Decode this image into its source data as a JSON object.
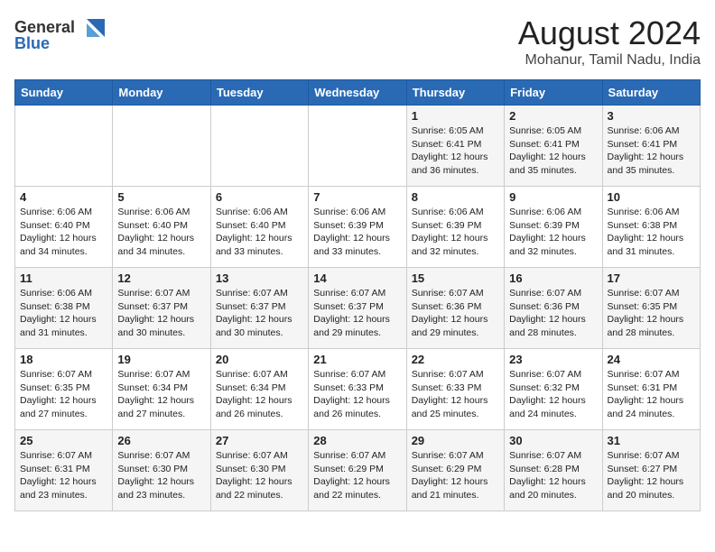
{
  "logo": {
    "line1": "General",
    "line2": "Blue"
  },
  "title": {
    "month_year": "August 2024",
    "location": "Mohanur, Tamil Nadu, India"
  },
  "days_of_week": [
    "Sunday",
    "Monday",
    "Tuesday",
    "Wednesday",
    "Thursday",
    "Friday",
    "Saturday"
  ],
  "weeks": [
    [
      {
        "day": "",
        "info": ""
      },
      {
        "day": "",
        "info": ""
      },
      {
        "day": "",
        "info": ""
      },
      {
        "day": "",
        "info": ""
      },
      {
        "day": "1",
        "info": "Sunrise: 6:05 AM\nSunset: 6:41 PM\nDaylight: 12 hours\nand 36 minutes."
      },
      {
        "day": "2",
        "info": "Sunrise: 6:05 AM\nSunset: 6:41 PM\nDaylight: 12 hours\nand 35 minutes."
      },
      {
        "day": "3",
        "info": "Sunrise: 6:06 AM\nSunset: 6:41 PM\nDaylight: 12 hours\nand 35 minutes."
      }
    ],
    [
      {
        "day": "4",
        "info": "Sunrise: 6:06 AM\nSunset: 6:40 PM\nDaylight: 12 hours\nand 34 minutes."
      },
      {
        "day": "5",
        "info": "Sunrise: 6:06 AM\nSunset: 6:40 PM\nDaylight: 12 hours\nand 34 minutes."
      },
      {
        "day": "6",
        "info": "Sunrise: 6:06 AM\nSunset: 6:40 PM\nDaylight: 12 hours\nand 33 minutes."
      },
      {
        "day": "7",
        "info": "Sunrise: 6:06 AM\nSunset: 6:39 PM\nDaylight: 12 hours\nand 33 minutes."
      },
      {
        "day": "8",
        "info": "Sunrise: 6:06 AM\nSunset: 6:39 PM\nDaylight: 12 hours\nand 32 minutes."
      },
      {
        "day": "9",
        "info": "Sunrise: 6:06 AM\nSunset: 6:39 PM\nDaylight: 12 hours\nand 32 minutes."
      },
      {
        "day": "10",
        "info": "Sunrise: 6:06 AM\nSunset: 6:38 PM\nDaylight: 12 hours\nand 31 minutes."
      }
    ],
    [
      {
        "day": "11",
        "info": "Sunrise: 6:06 AM\nSunset: 6:38 PM\nDaylight: 12 hours\nand 31 minutes."
      },
      {
        "day": "12",
        "info": "Sunrise: 6:07 AM\nSunset: 6:37 PM\nDaylight: 12 hours\nand 30 minutes."
      },
      {
        "day": "13",
        "info": "Sunrise: 6:07 AM\nSunset: 6:37 PM\nDaylight: 12 hours\nand 30 minutes."
      },
      {
        "day": "14",
        "info": "Sunrise: 6:07 AM\nSunset: 6:37 PM\nDaylight: 12 hours\nand 29 minutes."
      },
      {
        "day": "15",
        "info": "Sunrise: 6:07 AM\nSunset: 6:36 PM\nDaylight: 12 hours\nand 29 minutes."
      },
      {
        "day": "16",
        "info": "Sunrise: 6:07 AM\nSunset: 6:36 PM\nDaylight: 12 hours\nand 28 minutes."
      },
      {
        "day": "17",
        "info": "Sunrise: 6:07 AM\nSunset: 6:35 PM\nDaylight: 12 hours\nand 28 minutes."
      }
    ],
    [
      {
        "day": "18",
        "info": "Sunrise: 6:07 AM\nSunset: 6:35 PM\nDaylight: 12 hours\nand 27 minutes."
      },
      {
        "day": "19",
        "info": "Sunrise: 6:07 AM\nSunset: 6:34 PM\nDaylight: 12 hours\nand 27 minutes."
      },
      {
        "day": "20",
        "info": "Sunrise: 6:07 AM\nSunset: 6:34 PM\nDaylight: 12 hours\nand 26 minutes."
      },
      {
        "day": "21",
        "info": "Sunrise: 6:07 AM\nSunset: 6:33 PM\nDaylight: 12 hours\nand 26 minutes."
      },
      {
        "day": "22",
        "info": "Sunrise: 6:07 AM\nSunset: 6:33 PM\nDaylight: 12 hours\nand 25 minutes."
      },
      {
        "day": "23",
        "info": "Sunrise: 6:07 AM\nSunset: 6:32 PM\nDaylight: 12 hours\nand 24 minutes."
      },
      {
        "day": "24",
        "info": "Sunrise: 6:07 AM\nSunset: 6:31 PM\nDaylight: 12 hours\nand 24 minutes."
      }
    ],
    [
      {
        "day": "25",
        "info": "Sunrise: 6:07 AM\nSunset: 6:31 PM\nDaylight: 12 hours\nand 23 minutes."
      },
      {
        "day": "26",
        "info": "Sunrise: 6:07 AM\nSunset: 6:30 PM\nDaylight: 12 hours\nand 23 minutes."
      },
      {
        "day": "27",
        "info": "Sunrise: 6:07 AM\nSunset: 6:30 PM\nDaylight: 12 hours\nand 22 minutes."
      },
      {
        "day": "28",
        "info": "Sunrise: 6:07 AM\nSunset: 6:29 PM\nDaylight: 12 hours\nand 22 minutes."
      },
      {
        "day": "29",
        "info": "Sunrise: 6:07 AM\nSunset: 6:29 PM\nDaylight: 12 hours\nand 21 minutes."
      },
      {
        "day": "30",
        "info": "Sunrise: 6:07 AM\nSunset: 6:28 PM\nDaylight: 12 hours\nand 20 minutes."
      },
      {
        "day": "31",
        "info": "Sunrise: 6:07 AM\nSunset: 6:27 PM\nDaylight: 12 hours\nand 20 minutes."
      }
    ]
  ]
}
